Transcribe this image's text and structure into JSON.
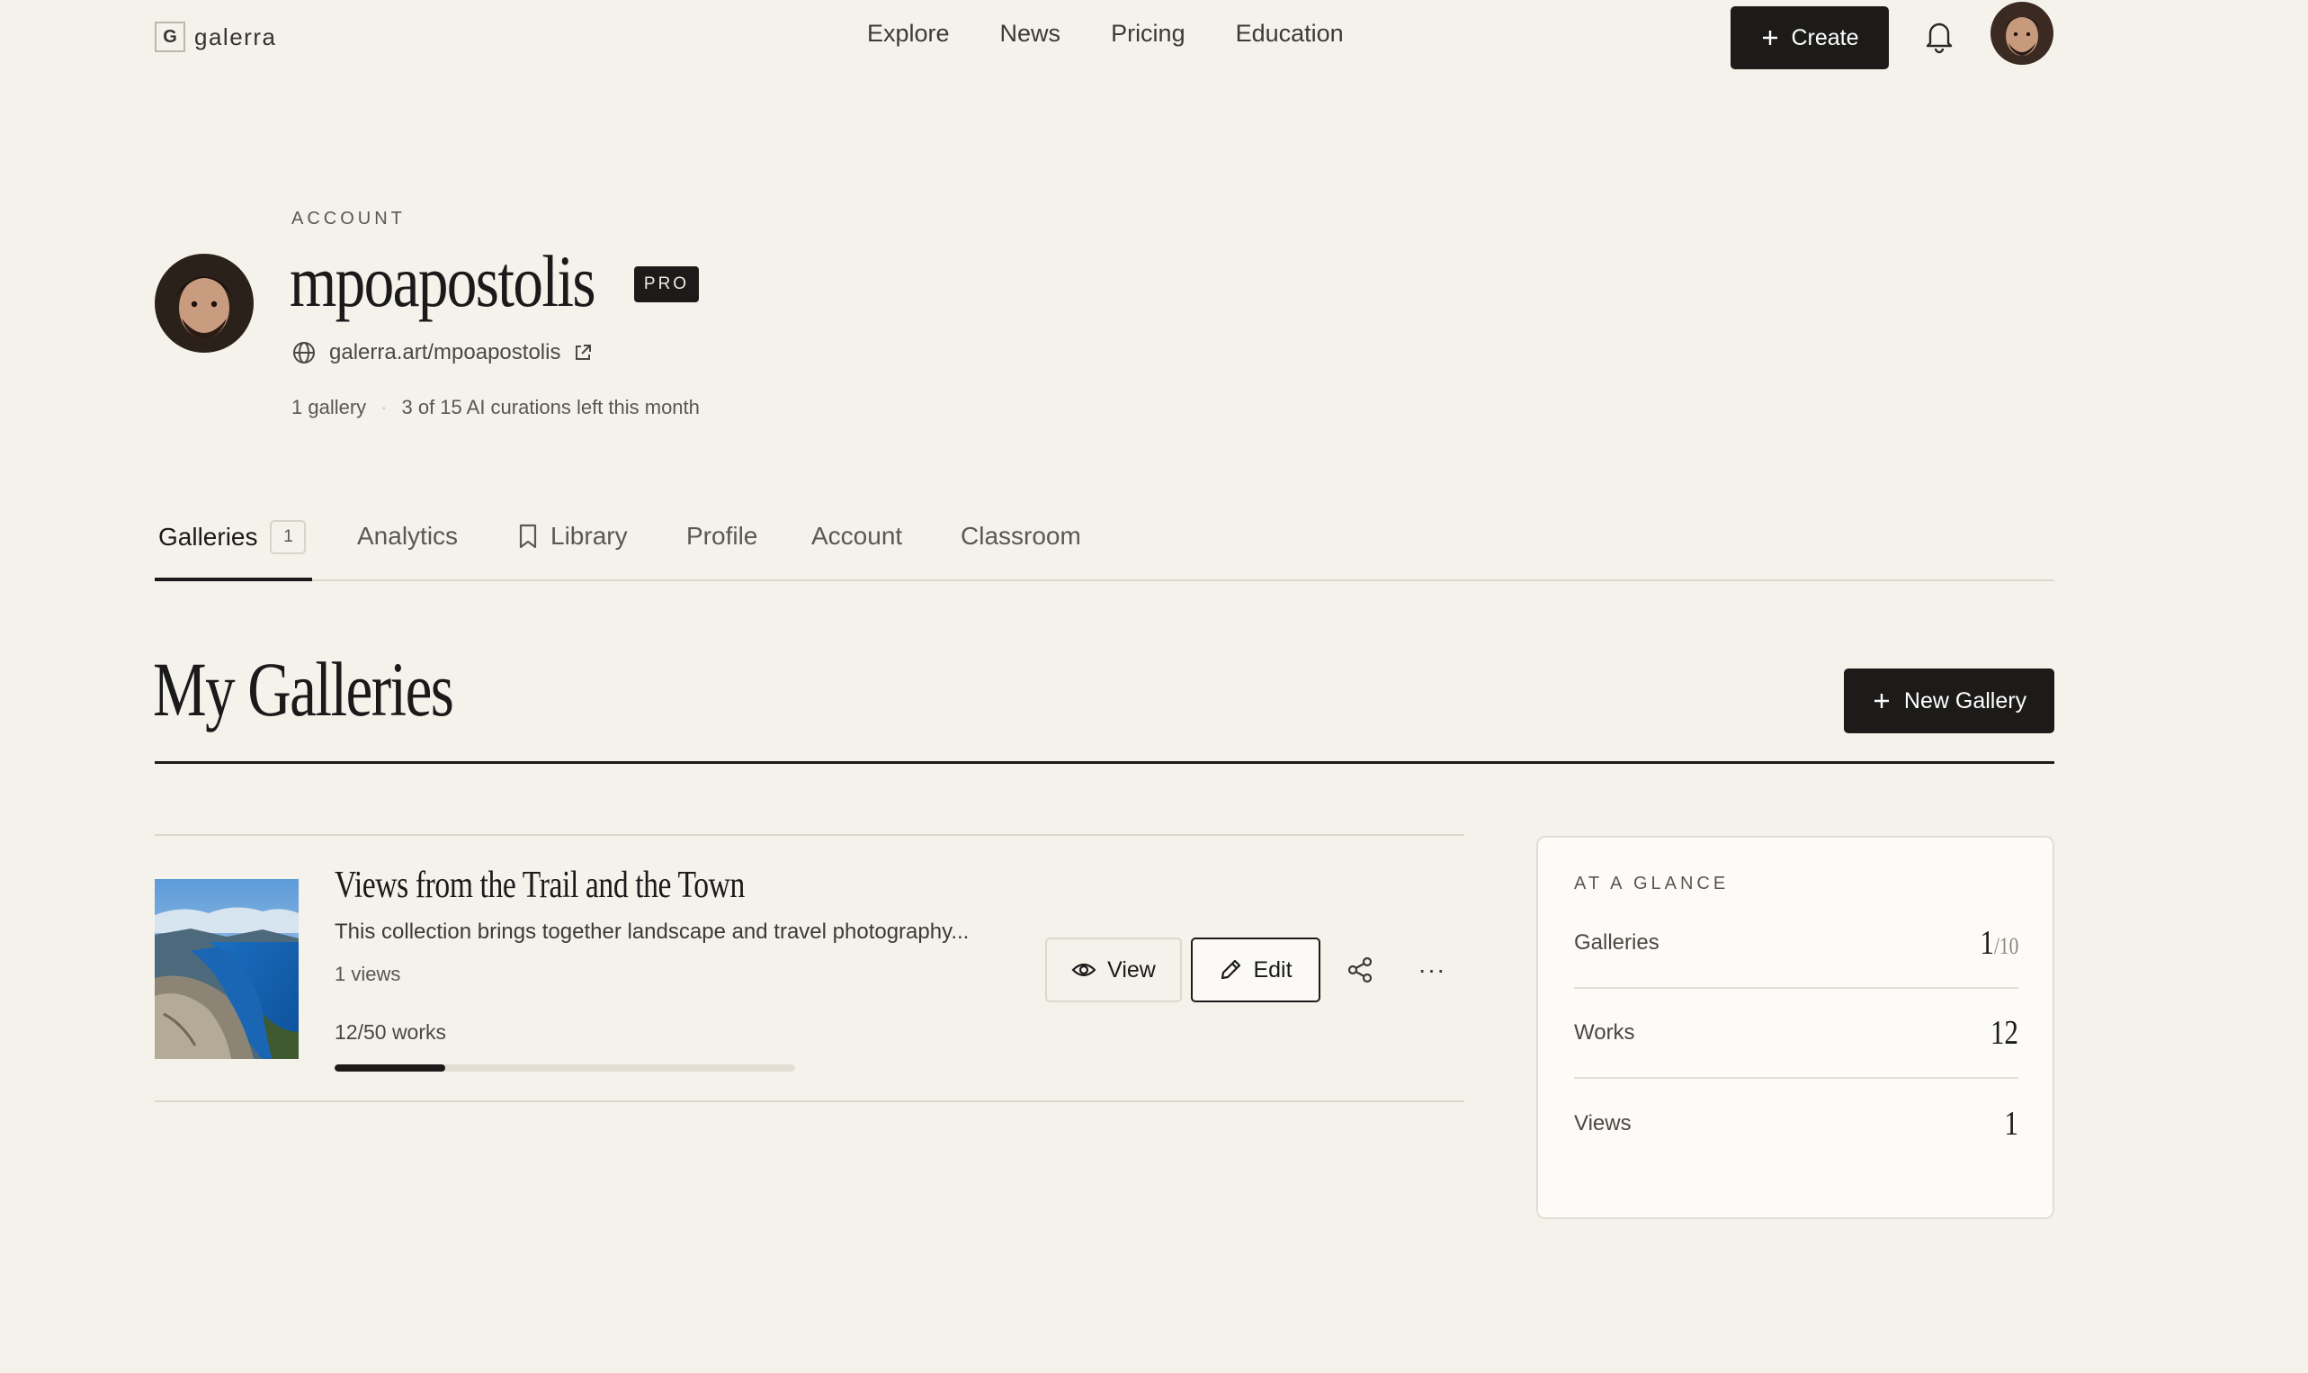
{
  "brand": {
    "logo_letter": "G",
    "name": "galerra"
  },
  "nav": {
    "links": [
      "Explore",
      "News",
      "Pricing",
      "Education"
    ],
    "create_label": "Create"
  },
  "header": {
    "kicker": "ACCOUNT",
    "username": "mpoapostolis",
    "badge": "PRO",
    "profile_url": "galerra.art/mpoapostolis",
    "gallery_count_text": "1 gallery",
    "separator": "·",
    "curations_text": "3 of 15 AI curations left this month"
  },
  "tabs": {
    "galleries": "Galleries",
    "galleries_count": "1",
    "analytics": "Analytics",
    "library": "Library",
    "profile": "Profile",
    "account": "Account",
    "classroom": "Classroom"
  },
  "section": {
    "title": "My Galleries",
    "new_gallery_label": "New Gallery"
  },
  "gallery": {
    "title": "Views from the Trail and the Town",
    "description": "This collection brings together landscape and travel photography...",
    "views_text": "1 views",
    "works_text": "12/50 works",
    "works_progress": 0.24,
    "view_label": "View",
    "edit_label": "Edit",
    "more_label": "···"
  },
  "glance": {
    "title": "AT A GLANCE",
    "galleries_label": "Galleries",
    "galleries_value": "1",
    "galleries_denom": "/10",
    "works_label": "Works",
    "works_value": "12",
    "views_label": "Views",
    "views_value": "1"
  },
  "colors": {
    "background": "#f5f2ec",
    "primary": "#1c1b19",
    "card": "#fcfbf7",
    "divider": "#dcd8d0"
  }
}
